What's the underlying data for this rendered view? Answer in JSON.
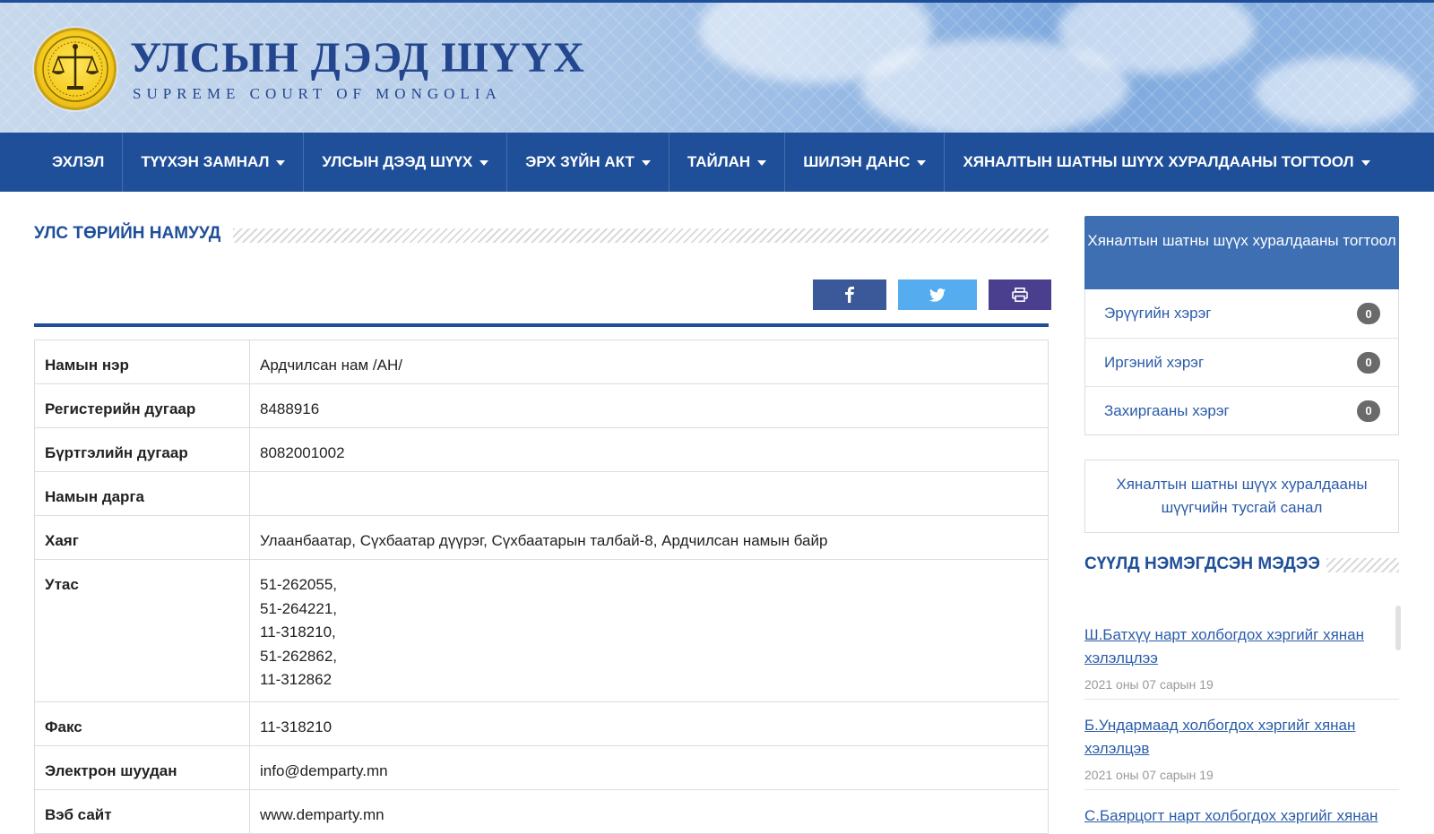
{
  "header": {
    "title_mn": "УЛСЫН ДЭЭД ШҮҮХ",
    "title_en": "SUPREME COURT OF MONGOLIA"
  },
  "nav": {
    "items": [
      {
        "label": "Эхлэл",
        "dropdown": false
      },
      {
        "label": "Түүхэн замнал",
        "dropdown": true
      },
      {
        "label": "Улсын Дээд Шүүх",
        "dropdown": true
      },
      {
        "label": "Эрх зүйн акт",
        "dropdown": true
      },
      {
        "label": "Тайлан",
        "dropdown": true
      },
      {
        "label": "Шилэн данс",
        "dropdown": true
      },
      {
        "label": "Хяналтын шатны шүүх хуралдааны тогтоол",
        "dropdown": true
      }
    ]
  },
  "main": {
    "section_title": "УЛС ТӨРИЙН НАМУУД",
    "share": {
      "facebook_color": "#3b5998",
      "twitter_color": "#55acee",
      "print_color": "#4a3f8f"
    },
    "rows": [
      {
        "label": "Намын нэр",
        "value": "Ардчилсан нам /АН/"
      },
      {
        "label": "Регистерийн дугаар",
        "value": "8488916"
      },
      {
        "label": "Бүртгэлийн дугаар",
        "value": "8082001002"
      },
      {
        "label": "Намын дарга",
        "value": ""
      },
      {
        "label": "Хаяг",
        "value": "Улаанбаатар, Сүхбаатар дүүрэг, Сүхбаатарын талбай-8, Ардчилсан намын байр"
      },
      {
        "label": "Утас",
        "lines": [
          "51-262055,",
          "51-264221,",
          "11-318210,",
          "51-262862,",
          "11-312862"
        ]
      },
      {
        "label": "Факс",
        "value": "11-318210"
      },
      {
        "label": "Электрон шуудан",
        "value": "info@demparty.mn"
      },
      {
        "label": "Вэб сайт",
        "value": "www.demparty.mn"
      }
    ]
  },
  "sidebar": {
    "box_title": "Хяналтын шатны шүүх хуралдааны тогтоол",
    "categories": [
      {
        "label": "Эрүүгийн хэрэг",
        "count": "0"
      },
      {
        "label": "Иргэний хэрэг",
        "count": "0"
      },
      {
        "label": "Захиргааны хэрэг",
        "count": "0"
      }
    ],
    "box2_title": "Хяналтын шатны шүүх хуралдааны шүүгчийн тусгай санал",
    "news_title": "СҮҮЛД НЭМЭГДСЭН МЭДЭЭ",
    "news": [
      {
        "title": "Ш.Батхүү нарт холбогдох хэргийг хянан хэлэлцлээ",
        "date": "2021 оны 07 сарын 19"
      },
      {
        "title": "Б.Ундармаад холбогдох хэргийг хянан хэлэлцэв",
        "date": "2021 оны 07 сарын 19"
      },
      {
        "title": "С.Баярцогт нарт холбогдох хэргийг хянан хэлэлцлээ",
        "date": ""
      }
    ]
  },
  "colors": {
    "primary": "#1f4f99",
    "sidebar_head": "#3e6fb3",
    "link": "#2b5ca8",
    "badge": "#6a6a6a"
  }
}
